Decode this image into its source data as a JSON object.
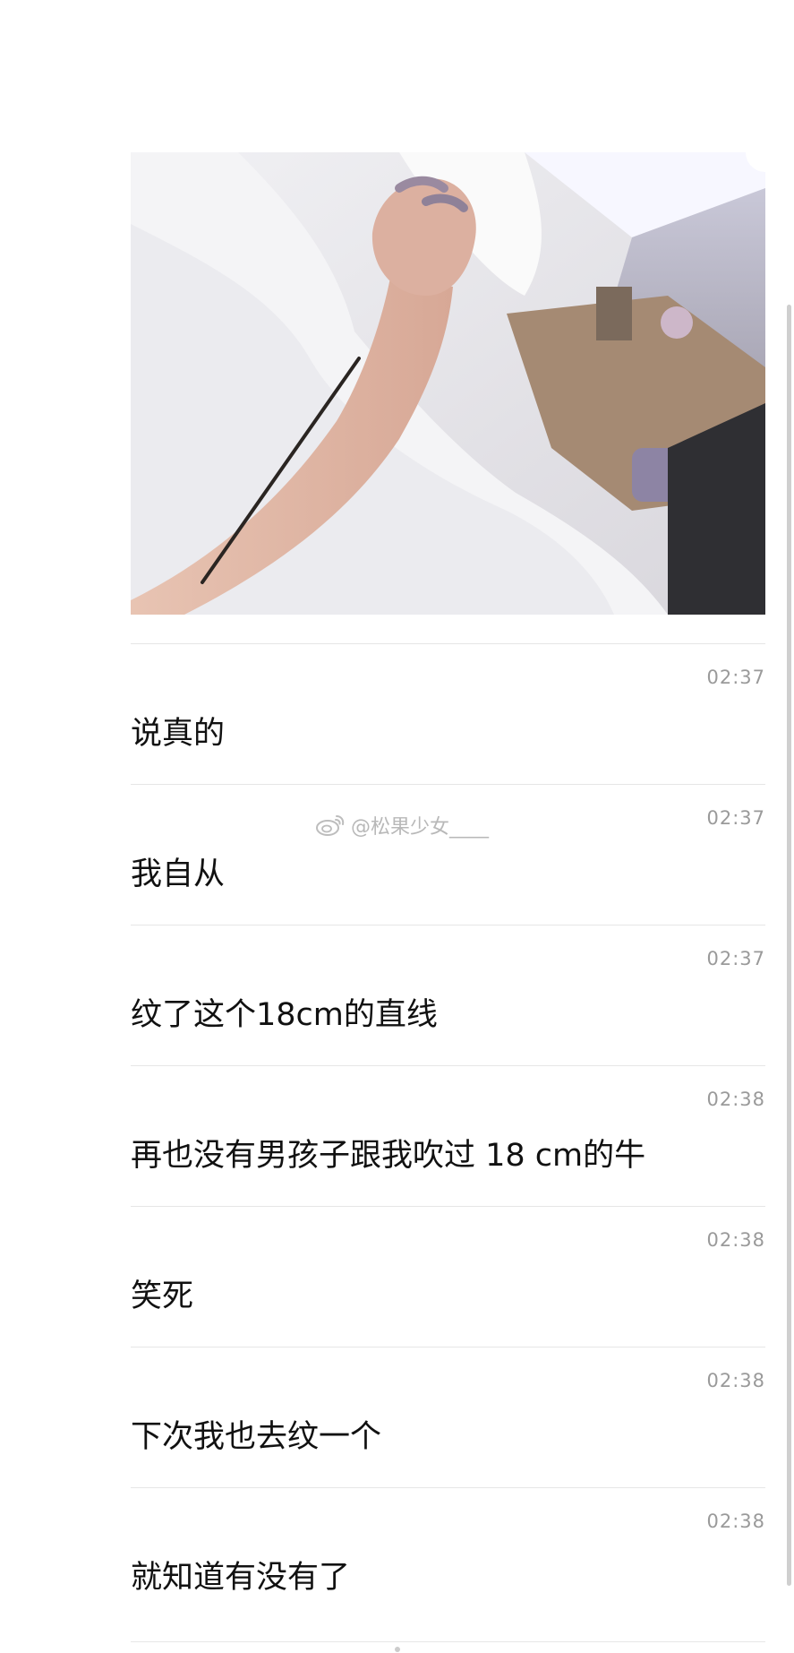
{
  "watermark": {
    "text": "@松果少女____",
    "icon": "weibo-icon"
  },
  "photo": {
    "icon": "photo-image"
  },
  "messages": [
    {
      "time": "02:37",
      "text": "说真的"
    },
    {
      "time": "02:37",
      "text": "我自从"
    },
    {
      "time": "02:37",
      "text": "纹了这个18cm的直线"
    },
    {
      "time": "02:38",
      "text": "再也没有男孩子跟我吹过 18 cm的牛"
    },
    {
      "time": "02:38",
      "text": "笑死"
    },
    {
      "time": "02:38",
      "text": "下次我也去纹一个"
    },
    {
      "time": "02:38",
      "text": "就知道有没有了"
    }
  ]
}
